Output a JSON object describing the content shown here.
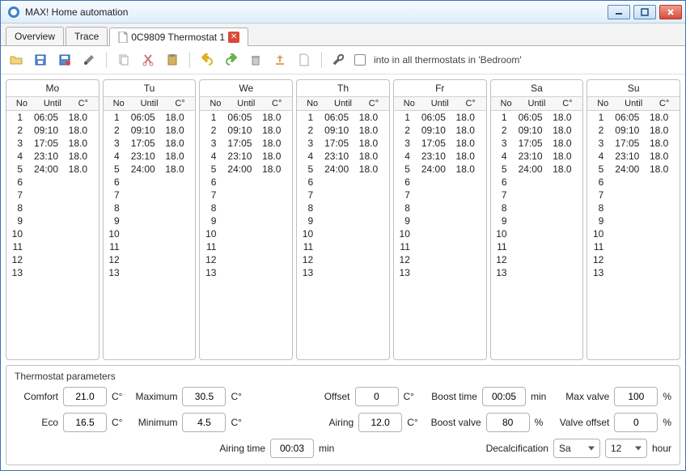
{
  "window": {
    "title": "MAX! Home automation"
  },
  "tabs": [
    {
      "label": "Overview"
    },
    {
      "label": "Trace"
    },
    {
      "label": "0C9809 Thermostat 1",
      "closable": true,
      "active": true
    }
  ],
  "toolbar": {
    "label": "into in all thermostats in 'Bedroom'"
  },
  "schedule": {
    "columns": {
      "no": "No",
      "until": "Until",
      "temp": "C°"
    },
    "days": [
      {
        "name": "Mo",
        "rows": [
          {
            "no": 1,
            "until": "06:05",
            "temp": "18.0"
          },
          {
            "no": 2,
            "until": "09:10",
            "temp": "18.0"
          },
          {
            "no": 3,
            "until": "17:05",
            "temp": "18.0"
          },
          {
            "no": 4,
            "until": "23:10",
            "temp": "18.0"
          },
          {
            "no": 5,
            "until": "24:00",
            "temp": "18.0"
          },
          {
            "no": 6
          },
          {
            "no": 7
          },
          {
            "no": 8
          },
          {
            "no": 9
          },
          {
            "no": 10
          },
          {
            "no": 11
          },
          {
            "no": 12
          },
          {
            "no": 13
          }
        ]
      },
      {
        "name": "Tu",
        "rows": [
          {
            "no": 1,
            "until": "06:05",
            "temp": "18.0"
          },
          {
            "no": 2,
            "until": "09:10",
            "temp": "18.0"
          },
          {
            "no": 3,
            "until": "17:05",
            "temp": "18.0"
          },
          {
            "no": 4,
            "until": "23:10",
            "temp": "18.0"
          },
          {
            "no": 5,
            "until": "24:00",
            "temp": "18.0"
          },
          {
            "no": 6
          },
          {
            "no": 7
          },
          {
            "no": 8
          },
          {
            "no": 9
          },
          {
            "no": 10
          },
          {
            "no": 11
          },
          {
            "no": 12
          },
          {
            "no": 13
          }
        ]
      },
      {
        "name": "We",
        "rows": [
          {
            "no": 1,
            "until": "06:05",
            "temp": "18.0"
          },
          {
            "no": 2,
            "until": "09:10",
            "temp": "18.0"
          },
          {
            "no": 3,
            "until": "17:05",
            "temp": "18.0"
          },
          {
            "no": 4,
            "until": "23:10",
            "temp": "18.0"
          },
          {
            "no": 5,
            "until": "24:00",
            "temp": "18.0"
          },
          {
            "no": 6
          },
          {
            "no": 7
          },
          {
            "no": 8
          },
          {
            "no": 9
          },
          {
            "no": 10
          },
          {
            "no": 11
          },
          {
            "no": 12
          },
          {
            "no": 13
          }
        ]
      },
      {
        "name": "Th",
        "rows": [
          {
            "no": 1,
            "until": "06:05",
            "temp": "18.0"
          },
          {
            "no": 2,
            "until": "09:10",
            "temp": "18.0"
          },
          {
            "no": 3,
            "until": "17:05",
            "temp": "18.0"
          },
          {
            "no": 4,
            "until": "23:10",
            "temp": "18.0"
          },
          {
            "no": 5,
            "until": "24:00",
            "temp": "18.0"
          },
          {
            "no": 6
          },
          {
            "no": 7
          },
          {
            "no": 8
          },
          {
            "no": 9
          },
          {
            "no": 10
          },
          {
            "no": 11
          },
          {
            "no": 12
          },
          {
            "no": 13
          }
        ]
      },
      {
        "name": "Fr",
        "rows": [
          {
            "no": 1,
            "until": "06:05",
            "temp": "18.0"
          },
          {
            "no": 2,
            "until": "09:10",
            "temp": "18.0"
          },
          {
            "no": 3,
            "until": "17:05",
            "temp": "18.0"
          },
          {
            "no": 4,
            "until": "23:10",
            "temp": "18.0"
          },
          {
            "no": 5,
            "until": "24:00",
            "temp": "18.0"
          },
          {
            "no": 6
          },
          {
            "no": 7
          },
          {
            "no": 8
          },
          {
            "no": 9
          },
          {
            "no": 10
          },
          {
            "no": 11
          },
          {
            "no": 12
          },
          {
            "no": 13
          }
        ]
      },
      {
        "name": "Sa",
        "rows": [
          {
            "no": 1,
            "until": "06:05",
            "temp": "18.0"
          },
          {
            "no": 2,
            "until": "09:10",
            "temp": "18.0"
          },
          {
            "no": 3,
            "until": "17:05",
            "temp": "18.0"
          },
          {
            "no": 4,
            "until": "23:10",
            "temp": "18.0"
          },
          {
            "no": 5,
            "until": "24:00",
            "temp": "18.0"
          },
          {
            "no": 6
          },
          {
            "no": 7
          },
          {
            "no": 8
          },
          {
            "no": 9
          },
          {
            "no": 10
          },
          {
            "no": 11
          },
          {
            "no": 12
          },
          {
            "no": 13
          }
        ]
      },
      {
        "name": "Su",
        "rows": [
          {
            "no": 1,
            "until": "06:05",
            "temp": "18.0"
          },
          {
            "no": 2,
            "until": "09:10",
            "temp": "18.0"
          },
          {
            "no": 3,
            "until": "17:05",
            "temp": "18.0"
          },
          {
            "no": 4,
            "until": "23:10",
            "temp": "18.0"
          },
          {
            "no": 5,
            "until": "24:00",
            "temp": "18.0"
          },
          {
            "no": 6
          },
          {
            "no": 7
          },
          {
            "no": 8
          },
          {
            "no": 9
          },
          {
            "no": 10
          },
          {
            "no": 11
          },
          {
            "no": 12
          },
          {
            "no": 13
          }
        ]
      }
    ]
  },
  "params": {
    "title": "Thermostat parameters",
    "labels": {
      "comfort": "Comfort",
      "eco": "Eco",
      "maximum": "Maximum",
      "minimum": "Minimum",
      "offset": "Offset",
      "airing": "Airing",
      "airing_time": "Airing time",
      "boost_time": "Boost time",
      "boost_valve": "Boost valve",
      "max_valve": "Max valve",
      "valve_offset": "Valve offset",
      "decalc": "Decalcification",
      "deg": "C°",
      "min": "min",
      "pct": "%",
      "hour": "hour"
    },
    "values": {
      "comfort": "21.0",
      "eco": "16.5",
      "maximum": "30.5",
      "minimum": "4.5",
      "offset": "0",
      "airing": "12.0",
      "airing_time": "00:03",
      "boost_time": "00:05",
      "boost_valve": "80",
      "max_valve": "100",
      "valve_offset": "0",
      "decalc_day": "Sa",
      "decalc_hour": "12"
    }
  }
}
